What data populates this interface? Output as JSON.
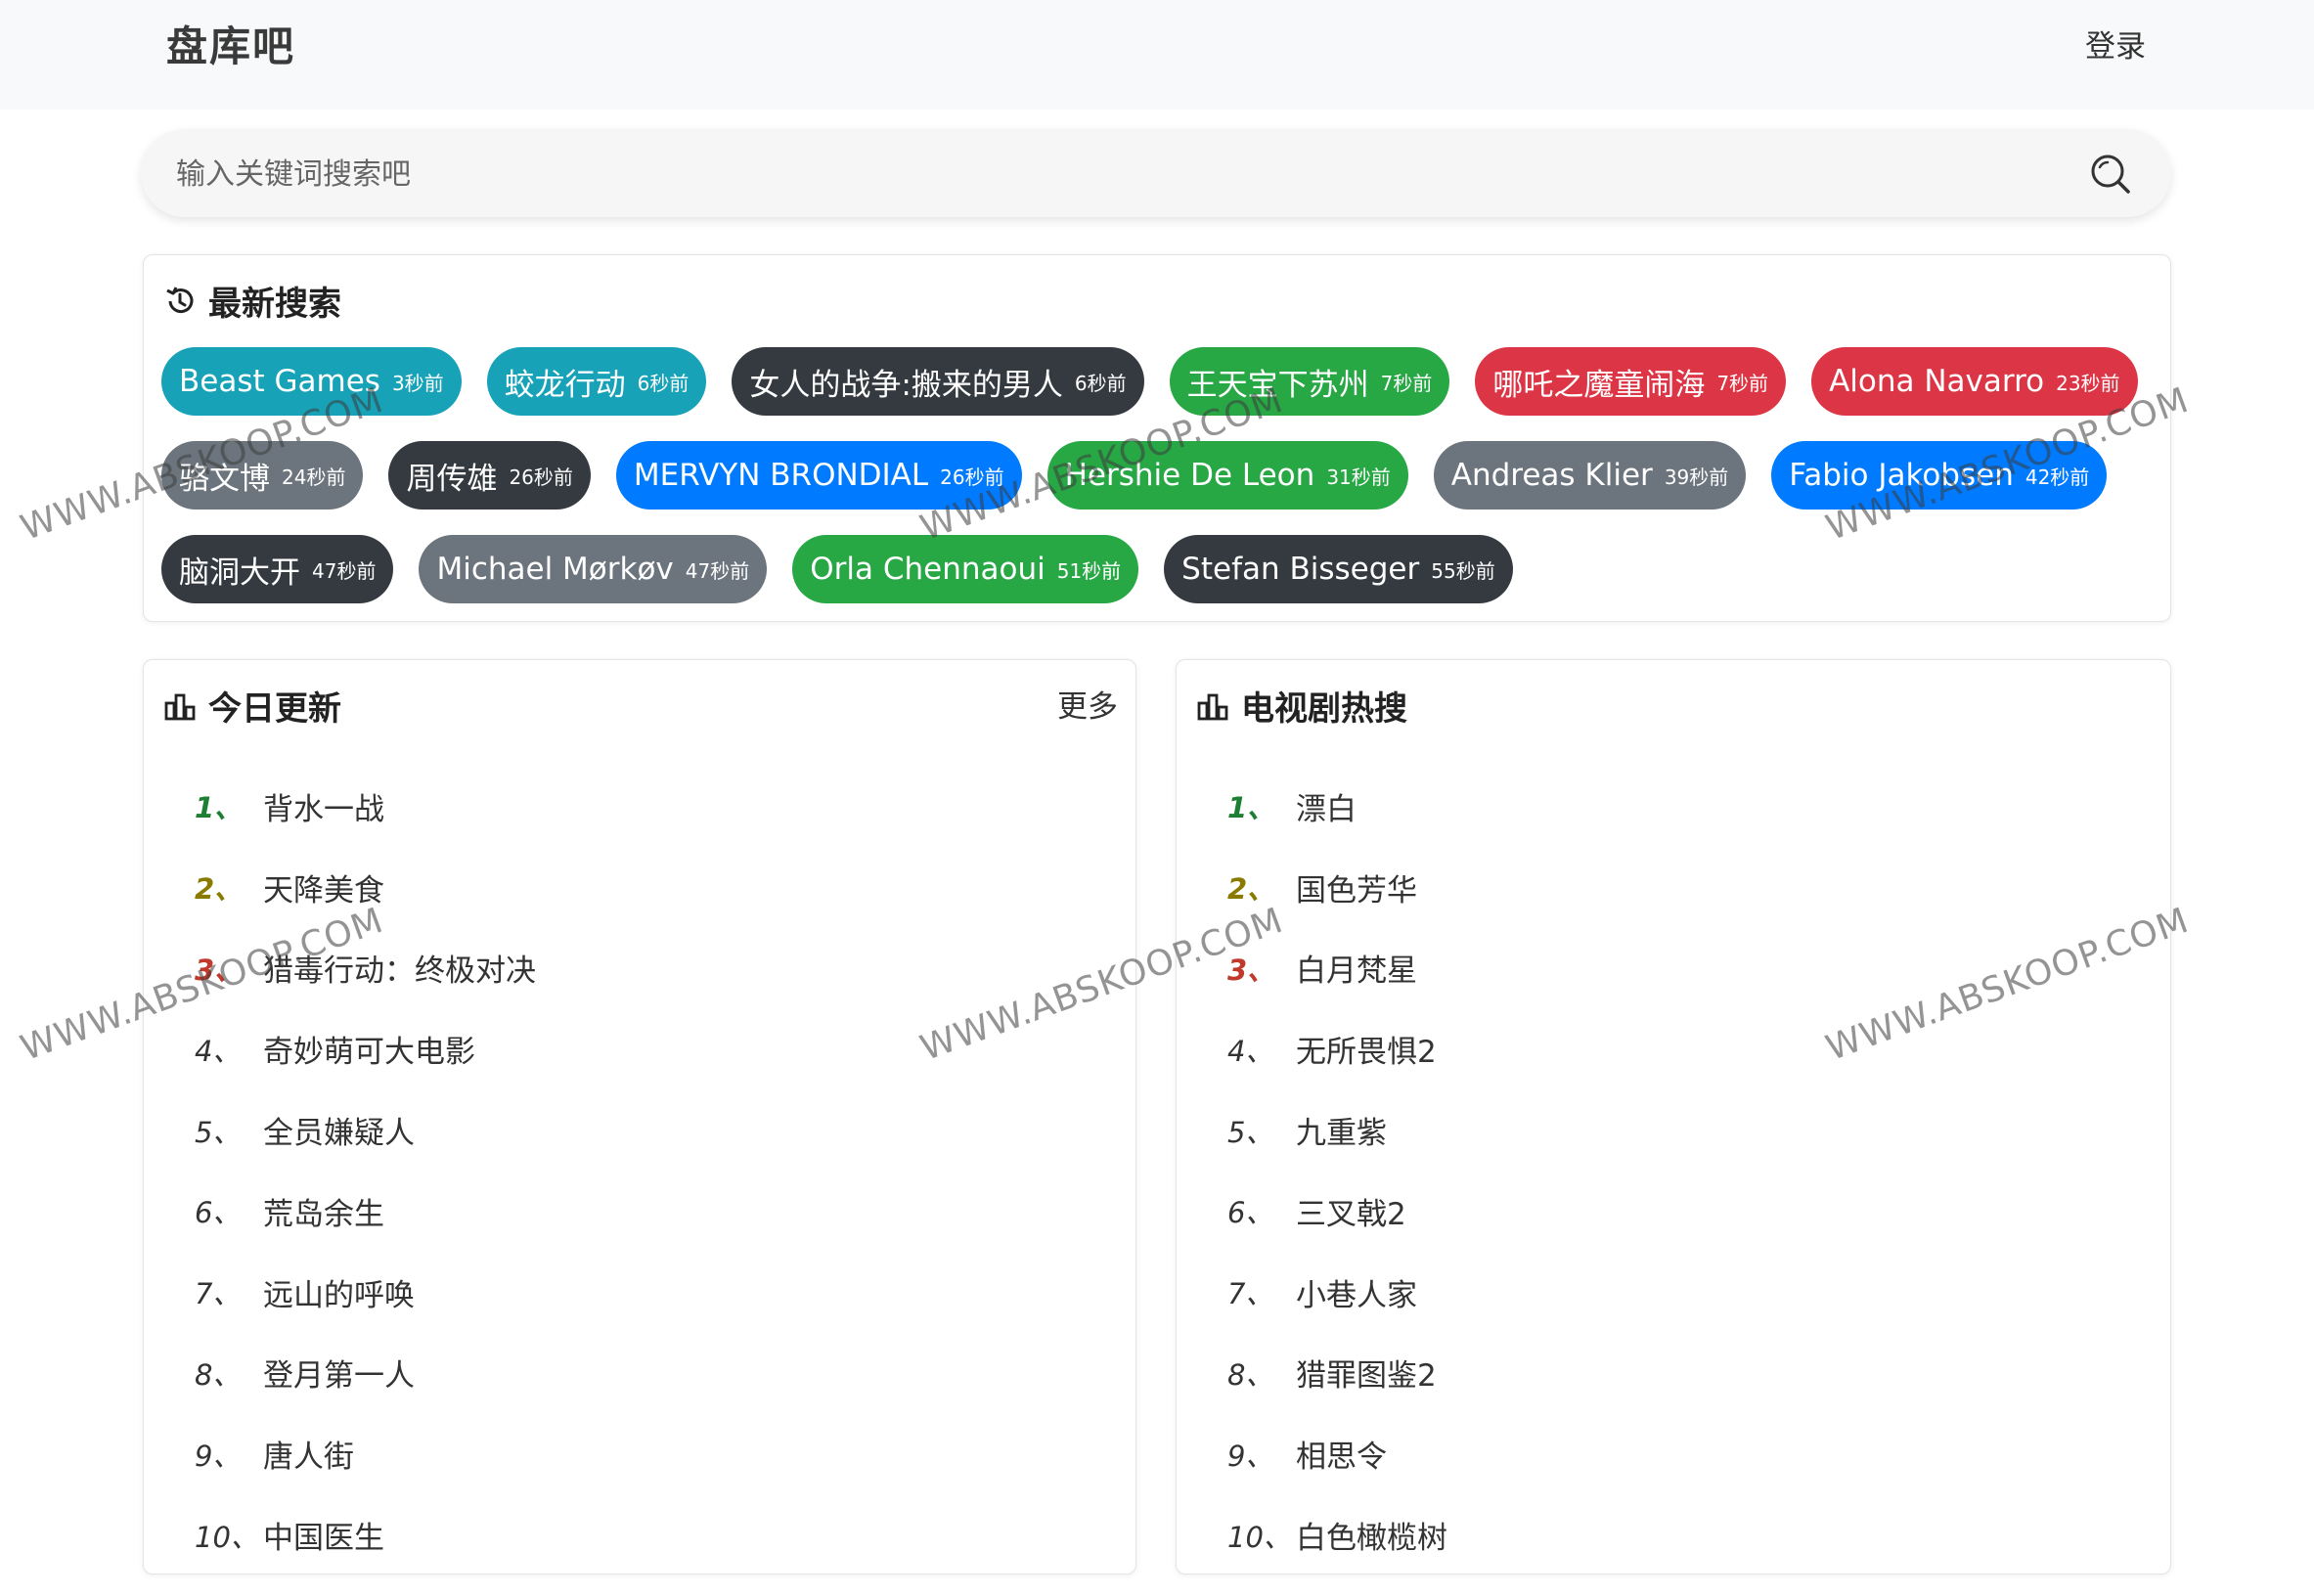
{
  "header": {
    "brand": "盘库吧",
    "login_label": "登录"
  },
  "search": {
    "placeholder": "输入关键词搜索吧"
  },
  "recent": {
    "title": "最新搜索",
    "tags": [
      {
        "label": "Beast Games",
        "time": "3秒前",
        "color": "#17a2b8"
      },
      {
        "label": "蛟龙行动",
        "time": "6秒前",
        "color": "#17a2b8"
      },
      {
        "label": "女人的战争:搬来的男人",
        "time": "6秒前",
        "color": "#343a40"
      },
      {
        "label": "王天宝下苏州",
        "time": "7秒前",
        "color": "#28a745"
      },
      {
        "label": "哪吒之魔童闹海",
        "time": "7秒前",
        "color": "#dc3545"
      },
      {
        "label": "Alona Navarro",
        "time": "23秒前",
        "color": "#dc3545"
      },
      {
        "label": "骆文博",
        "time": "24秒前",
        "color": "#6c757d"
      },
      {
        "label": "周传雄",
        "time": "26秒前",
        "color": "#343a40"
      },
      {
        "label": "MERVYN BRONDIAL",
        "time": "26秒前",
        "color": "#007bff"
      },
      {
        "label": "Hershie De Leon",
        "time": "31秒前",
        "color": "#28a745"
      },
      {
        "label": "Andreas Klier",
        "time": "39秒前",
        "color": "#6c757d"
      },
      {
        "label": "Fabio Jakobsen",
        "time": "42秒前",
        "color": "#007bff"
      },
      {
        "label": "脑洞大开",
        "time": "47秒前",
        "color": "#343a40"
      },
      {
        "label": "Michael Mørkøv",
        "time": "47秒前",
        "color": "#6c757d"
      },
      {
        "label": "Orla Chennaoui",
        "time": "51秒前",
        "color": "#28a745"
      },
      {
        "label": "Stefan Bisseger",
        "time": "55秒前",
        "color": "#343a40"
      }
    ]
  },
  "today": {
    "title": "今日更新",
    "more_label": "更多",
    "items": [
      {
        "rank": "1、",
        "title": "背水一战"
      },
      {
        "rank": "2、",
        "title": "天降美食"
      },
      {
        "rank": "3、",
        "title": "猎毒行动：终极对决"
      },
      {
        "rank": "4、",
        "title": "奇妙萌可大电影"
      },
      {
        "rank": "5、",
        "title": "全员嫌疑人"
      },
      {
        "rank": "6、",
        "title": "荒岛余生"
      },
      {
        "rank": "7、",
        "title": "远山的呼唤"
      },
      {
        "rank": "8、",
        "title": "登月第一人"
      },
      {
        "rank": "9、",
        "title": "唐人街"
      },
      {
        "rank": "10、",
        "title": "中国医生"
      }
    ]
  },
  "tv": {
    "title": "电视剧热搜",
    "items": [
      {
        "rank": "1、",
        "title": "漂白"
      },
      {
        "rank": "2、",
        "title": "国色芳华"
      },
      {
        "rank": "3、",
        "title": "白月梵星"
      },
      {
        "rank": "4、",
        "title": "无所畏惧2"
      },
      {
        "rank": "5、",
        "title": "九重紫"
      },
      {
        "rank": "6、",
        "title": "三叉戟2"
      },
      {
        "rank": "7、",
        "title": "小巷人家"
      },
      {
        "rank": "8、",
        "title": "猎罪图鉴2"
      },
      {
        "rank": "9、",
        "title": "相思令"
      },
      {
        "rank": "10、",
        "title": "白色橄榄树"
      }
    ]
  },
  "watermark": {
    "text": "WWW.ABSKOOP.COM"
  }
}
